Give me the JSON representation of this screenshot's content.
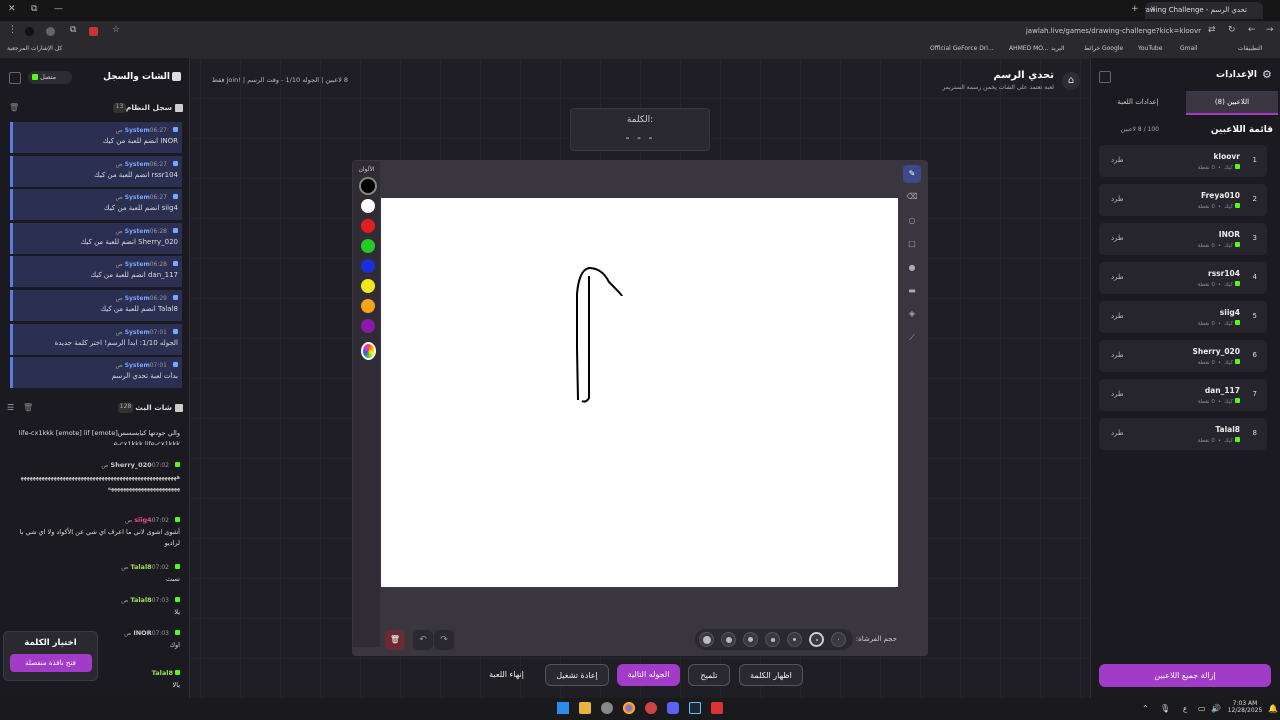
{
  "browser": {
    "tab_title": "تحدي الرسم - Drawing Challenge",
    "url": "jawlah.live/games/drawing-challenge?kick=kloovr",
    "bookmarks": [
      "Official GeForce Dri...",
      "AHMED MO...",
      "البريد",
      "خرائط Google",
      "YouTube",
      "Gmail",
      "التطبيقات",
      "كل الإشارات المرجعية"
    ]
  },
  "header": {
    "title": "تحدي الرسم",
    "subtitle": "لعبة تعتمد على الشات يخمن رسمة الستريمر",
    "players_count": "8 لاعبين",
    "round_info": "الجوله 1/10 - وقت الرسم",
    "join_hint": "!join فقط"
  },
  "word": {
    "label": "الكلمة:",
    "masked": "- - -"
  },
  "chat_panel": {
    "title": "الشات والسجل",
    "status": "متصل",
    "system_log": {
      "title": "سجل النظام",
      "count": "13",
      "messages": [
        {
          "name": "System",
          "time": "06:27 ص",
          "text": "INOR انضم للعبة من كيك"
        },
        {
          "name": "System",
          "time": "06:27 ص",
          "text": "rssr104 انضم للعبة من كيك"
        },
        {
          "name": "System",
          "time": "06:27 ص",
          "text": "siig4 انضم للعبة من كيك"
        },
        {
          "name": "System",
          "time": "06:28 ص",
          "text": "Sherry_020 انضم للعبة من كيك"
        },
        {
          "name": "System",
          "time": "06:28 ص",
          "text": "dan_117 انضم للعبة من كيك"
        },
        {
          "name": "System",
          "time": "06:29 ص",
          "text": "Talal8 انضم للعبة من كيك"
        },
        {
          "name": "System",
          "time": "07:01 ص",
          "text": "الجوله 1/10: ابدأ الرسم! اختر كلمة جديدة"
        },
        {
          "name": "System",
          "time": "07:01 ص",
          "text": "بدأت لعبة تحدي الرسم"
        }
      ]
    },
    "live_chat": {
      "title": "شات البث",
      "count": "128",
      "messages": [
        {
          "name": "",
          "time": "",
          "text": "والي جودتها كيابسسس[emote] life-cx1kkk [emote] life-cx1kkk life-cx1kkk",
          "color": "#ccc"
        },
        {
          "name": "Sherry_020",
          "time": "07:02 ص",
          "text": "ههههههههههههههههههههههههههههههههههههههههههههههههههههههههههههههههههههههههههههه",
          "color": "#ccc"
        },
        {
          "name": "siig4",
          "time": "07:02 ص",
          "text": "أشوى اشوى لاني ما اعرف اي شي عن الأكواد ولا اي شي بالراديو",
          "color": "#e84b8a"
        },
        {
          "name": "Talal8",
          "time": "07:02 ص",
          "text": "تست",
          "color": "#9be05b"
        },
        {
          "name": "Talal8",
          "time": "07:03 ص",
          "text": "يلا",
          "color": "#9be05b"
        },
        {
          "name": "INOR",
          "time": "07:03 ص",
          "text": "اوك",
          "color": "#ccc"
        },
        {
          "name": "Talal8",
          "time": "",
          "text": "يالا",
          "color": "#9be05b"
        }
      ]
    }
  },
  "word_choice": {
    "title": "اختيار الكلمة",
    "button": "فتح نافذة منفصلة"
  },
  "canvas": {
    "colors_label": "الألوان",
    "colors": [
      "#000000",
      "#ffffff",
      "#e02020",
      "#22cc22",
      "#1a2ee0",
      "#f5e61a",
      "#f5a31a",
      "#8a18a8"
    ],
    "brush_label": "حجم الفرشاة:"
  },
  "tools": [
    "pencil-icon",
    "eraser-icon",
    "circle-icon",
    "square-icon",
    "fill-circle-icon",
    "fill-rect-icon",
    "bucket-icon",
    "line-icon"
  ],
  "controls": {
    "show_word": "اظهار الكلمة",
    "hint": "تلميح",
    "next_round": "الجوله التالية",
    "restart": "إعادة تشغيل",
    "end_game": "إنهاء اللعبة"
  },
  "settings_panel": {
    "title": "الإعدادات",
    "tab_players": "اللاعبين (8)",
    "tab_game_settings": "إعدادات اللعبة",
    "list_title": "قائمة اللاعبين",
    "capacity": "100 / 8 لاعبين",
    "kick_label": "طرد",
    "score_text": "0 نقطة",
    "platform": "كيك",
    "players": [
      "kloovr",
      "Freya010",
      "INOR",
      "rssr104",
      "siig4",
      "Sherry_020",
      "dan_117",
      "Talal8"
    ],
    "remove_all": "إزالة جميع اللاعبين"
  },
  "taskbar": {
    "time": "7:03 AM",
    "date": "12/28/2025",
    "lang": "ع"
  },
  "colors": {
    "accent": "#a23bc7",
    "accent_dark": "#5a2a70",
    "kick_green": "#53fc18"
  }
}
